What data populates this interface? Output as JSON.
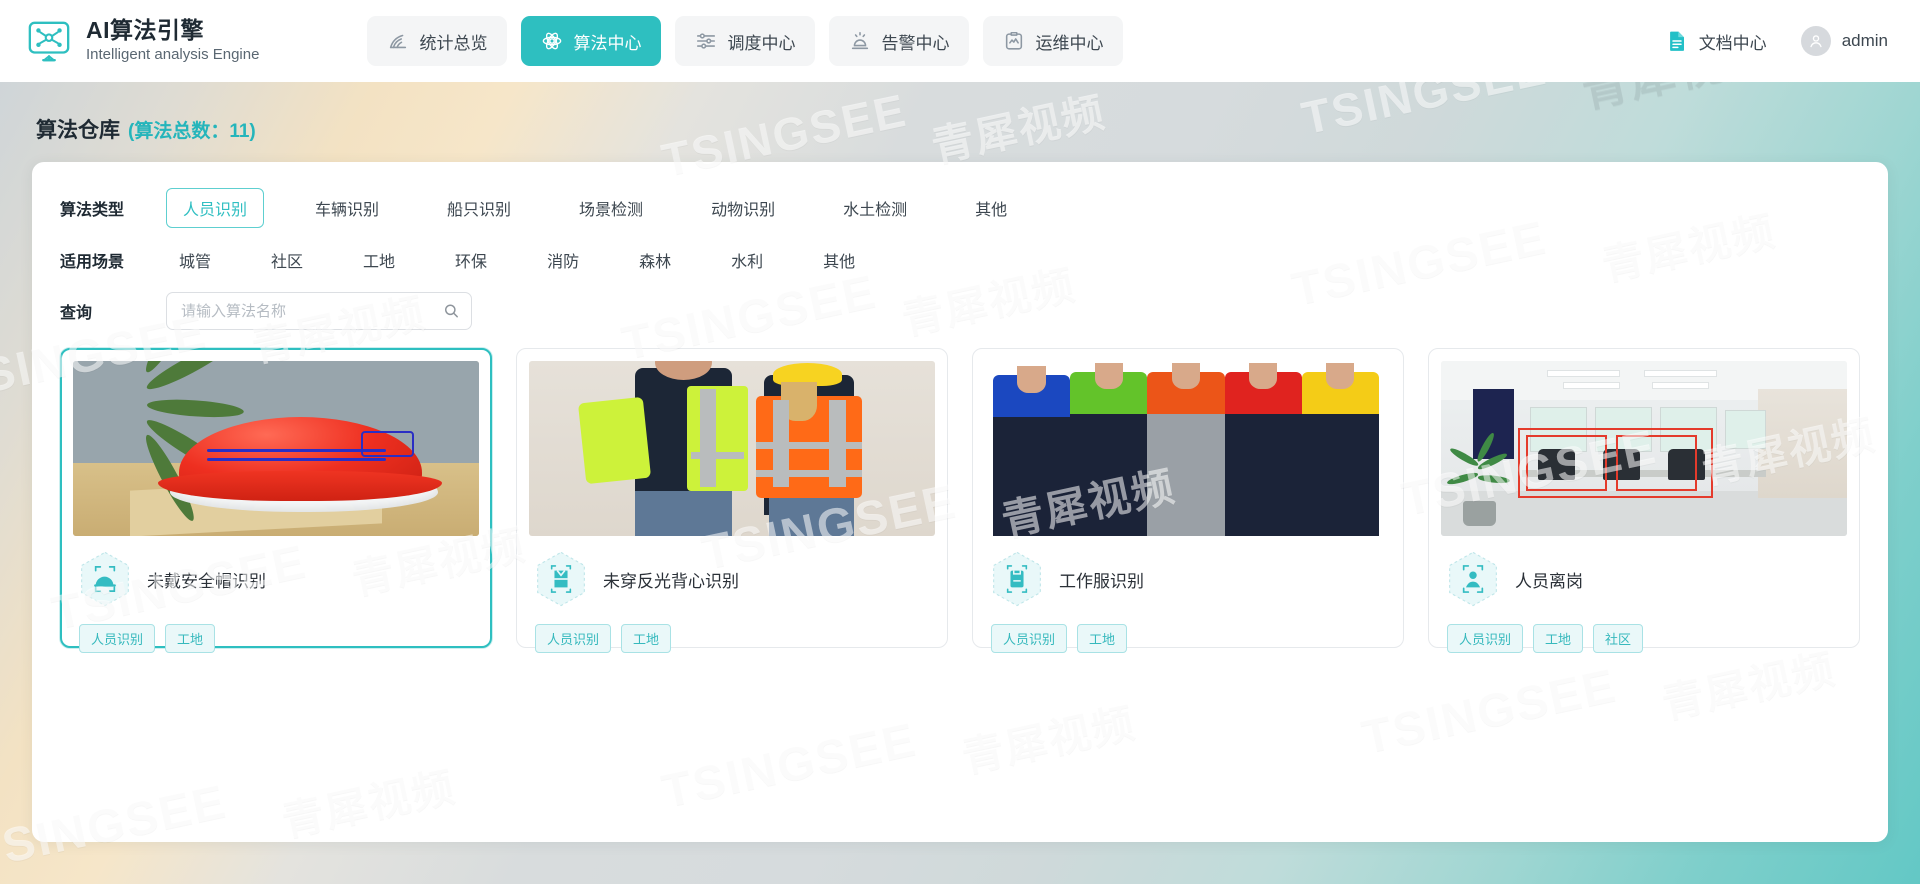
{
  "header": {
    "brand": {
      "title": "AI算法引擎",
      "subtitle": "Intelligent analysis Engine",
      "logo_icon": "monitor-network-icon"
    },
    "nav": [
      {
        "label": "统计总览",
        "icon": "chart-overview-icon",
        "active": false
      },
      {
        "label": "算法中心",
        "icon": "atom-algorithm-icon",
        "active": true
      },
      {
        "label": "调度中心",
        "icon": "sliders-schedule-icon",
        "active": false
      },
      {
        "label": "告警中心",
        "icon": "alarm-siren-icon",
        "active": false
      },
      {
        "label": "运维中心",
        "icon": "clipboard-monitor-icon",
        "active": false
      }
    ],
    "doc_center": {
      "label": "文档中心",
      "icon": "document-icon"
    },
    "user": {
      "name": "admin",
      "icon": "user-avatar-icon"
    },
    "accent_color": "#2ebfc0"
  },
  "page": {
    "title": "算法仓库",
    "count_text": "(算法总数：11)"
  },
  "filters": {
    "type": {
      "label": "算法类型",
      "options": [
        "人员识别",
        "车辆识别",
        "船只识别",
        "场景检测",
        "动物识别",
        "水土检测",
        "其他"
      ],
      "selected": "人员识别"
    },
    "scene": {
      "label": "适用场景",
      "options": [
        "城管",
        "社区",
        "工地",
        "环保",
        "消防",
        "森林",
        "水利",
        "其他"
      ],
      "selected": ""
    },
    "search": {
      "label": "查询",
      "placeholder": "请输入算法名称",
      "value": "",
      "icon": "search-icon"
    }
  },
  "cards": [
    {
      "title": "未戴安全帽识别",
      "icon": "helmet-hex-icon",
      "tags": [
        "人员识别",
        "工地"
      ],
      "selected": true,
      "thumb": "red-safety-helmet-on-desk"
    },
    {
      "title": "未穿反光背心识别",
      "icon": "vest-hex-icon",
      "tags": [
        "人员识别",
        "工地"
      ],
      "selected": false,
      "thumb": "two-workers-in-hi-vis-vests"
    },
    {
      "title": "工作服识别",
      "icon": "uniform-hex-icon",
      "tags": [
        "人员识别",
        "工地"
      ],
      "selected": false,
      "thumb": "five-workers-in-uniforms"
    },
    {
      "title": "人员离岗",
      "icon": "person-scan-hex-icon",
      "tags": [
        "人员识别",
        "工地",
        "社区"
      ],
      "selected": false,
      "thumb": "office-room-with-detection-boxes"
    }
  ],
  "watermarks": {
    "brand_latin": "TSINGSEE",
    "brand_cjk": "青犀视频"
  }
}
